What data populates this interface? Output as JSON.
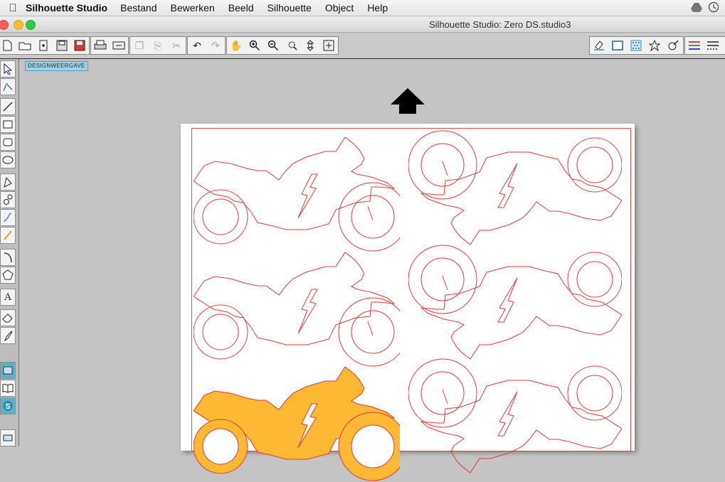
{
  "menubar": {
    "app_name": "Silhouette Studio",
    "items": [
      "Bestand",
      "Bewerken",
      "Beeld",
      "Silhouette",
      "Object",
      "Help"
    ]
  },
  "window": {
    "title": "Silhouette Studio: Zero DS.studio3"
  },
  "canvas": {
    "view_label": "DESIGNWEERGAVE"
  },
  "colors": {
    "cut_line": "#e03a3a",
    "fill": "#fdb933",
    "accent": "#5cb0c8"
  }
}
